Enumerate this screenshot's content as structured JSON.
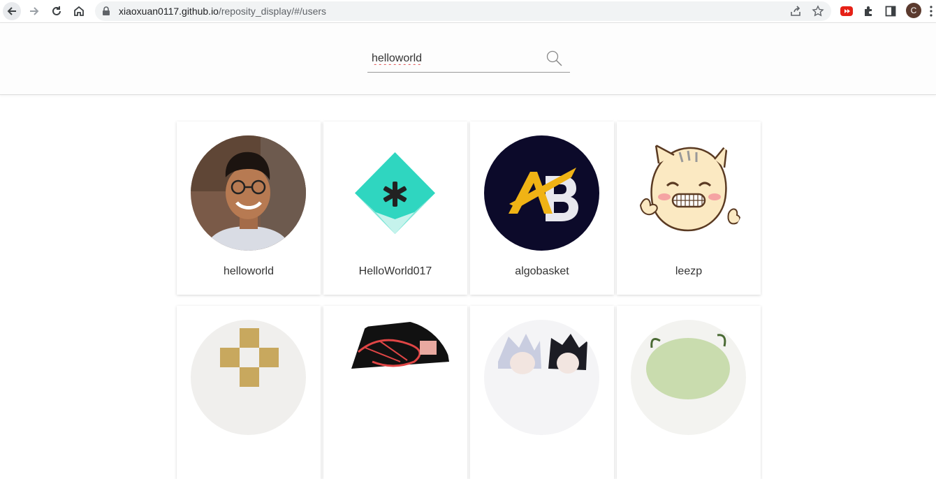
{
  "browser": {
    "url_host": "xiaoxuan0117.github.io",
    "url_path": "/reposity_display/#/users",
    "profile_initial": "C"
  },
  "search": {
    "value": "helloworld",
    "placeholder": ""
  },
  "users": [
    {
      "name": "helloworld",
      "avatar": "person-photo"
    },
    {
      "name": "HelloWorld017",
      "avatar": "teal-star-logo"
    },
    {
      "name": "algobasket",
      "avatar": "ab-logo"
    },
    {
      "name": "leezp",
      "avatar": "cartoon-cat"
    },
    {
      "name": "",
      "avatar": "gold-blocks"
    },
    {
      "name": "",
      "avatar": "red-scribble"
    },
    {
      "name": "",
      "avatar": "anime-characters"
    },
    {
      "name": "",
      "avatar": "green-creature"
    }
  ],
  "colors": {
    "teal_logo": "#2fd6c0",
    "ab_background": "#0c0a2a",
    "ab_gold": "#f0b315"
  }
}
